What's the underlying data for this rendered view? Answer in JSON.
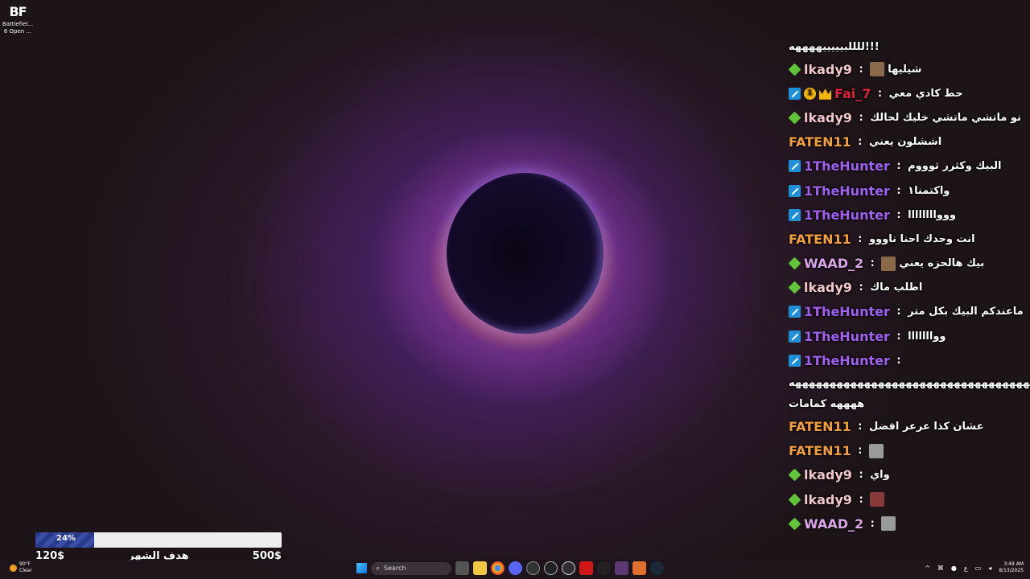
{
  "desktop": {
    "icon_logo": "BF",
    "icon_label_line1": "Battlefiel...",
    "icon_label_line2": "6 Open ..."
  },
  "chat": {
    "messages": [
      {
        "continuation": true,
        "text": "!!!للللبيييييههههه"
      },
      {
        "badges": [
          "diamond"
        ],
        "user": "lkady9",
        "user_color": "kady",
        "text": "شيليها",
        "emote": "brown"
      },
      {
        "badges": [
          "sword",
          "coin",
          "crown"
        ],
        "user": "Fai_7",
        "user_color": "fai",
        "text": "حط كادي معي"
      },
      {
        "badges": [
          "diamond"
        ],
        "user": "lkady9",
        "user_color": "kady",
        "text": "نو ماتشي ماتشي خليك لحالك"
      },
      {
        "badges": [],
        "user": "FATEN11",
        "user_color": "faten",
        "text": "اششلون يعني"
      },
      {
        "badges": [
          "sword"
        ],
        "user": "1TheHunter",
        "user_color": "hunter",
        "text": "البيك وكثرر ثوووم"
      },
      {
        "badges": [
          "sword"
        ],
        "user": "1TheHunter",
        "user_color": "hunter",
        "text": "واكتمنا١"
      },
      {
        "badges": [
          "sword"
        ],
        "user": "1TheHunter",
        "user_color": "hunter",
        "text": "ووواااااااا"
      },
      {
        "badges": [],
        "user": "FATEN11",
        "user_color": "faten",
        "text": "انت وحدك احنا ناووو"
      },
      {
        "badges": [
          "diamond"
        ],
        "user": "WAAD_2",
        "user_color": "waad",
        "text": "بيك هالحزه يعني",
        "emote": "brown"
      },
      {
        "badges": [
          "diamond"
        ],
        "user": "lkady9",
        "user_color": "kady",
        "text": "اطلب ماك"
      },
      {
        "badges": [
          "sword"
        ],
        "user": "1TheHunter",
        "user_color": "hunter",
        "text": "ماعندكم البيك بكل متر"
      },
      {
        "badges": [
          "sword"
        ],
        "user": "1TheHunter",
        "user_color": "hunter",
        "text": "ووااااااا"
      },
      {
        "badges": [
          "sword"
        ],
        "user": "1TheHunter",
        "user_color": "hunter",
        "text": ""
      },
      {
        "continuation": true,
        "text": "هههههههههههههههههههههههههههههههههههههه"
      },
      {
        "continuation": true,
        "text": "ههههه كمامات"
      },
      {
        "badges": [],
        "user": "FATEN11",
        "user_color": "faten",
        "text": "عشان كذا عرعر افضل"
      },
      {
        "badges": [],
        "user": "FATEN11",
        "user_color": "faten",
        "text": "",
        "emote": "gray"
      },
      {
        "badges": [
          "diamond"
        ],
        "user": "lkady9",
        "user_color": "kady",
        "text": "واي"
      },
      {
        "badges": [
          "diamond"
        ],
        "user": "lkady9",
        "user_color": "kady",
        "text": "",
        "emote": "red"
      },
      {
        "badges": [
          "diamond"
        ],
        "user": "WAAD_2",
        "user_color": "waad",
        "text": "",
        "emote": "gray"
      }
    ],
    "separator": " : "
  },
  "goal": {
    "progress_label": "24%",
    "progress_fraction": 0.24,
    "start_label": "120$",
    "title": "هدف الشهر",
    "end_label": "500$"
  },
  "taskbar": {
    "weather_temp": "90°F",
    "weather_desc": "Clear",
    "search_placeholder": "Search",
    "clock_time": "3:49 AM",
    "clock_date": "8/13/2025",
    "lang": "ع"
  }
}
